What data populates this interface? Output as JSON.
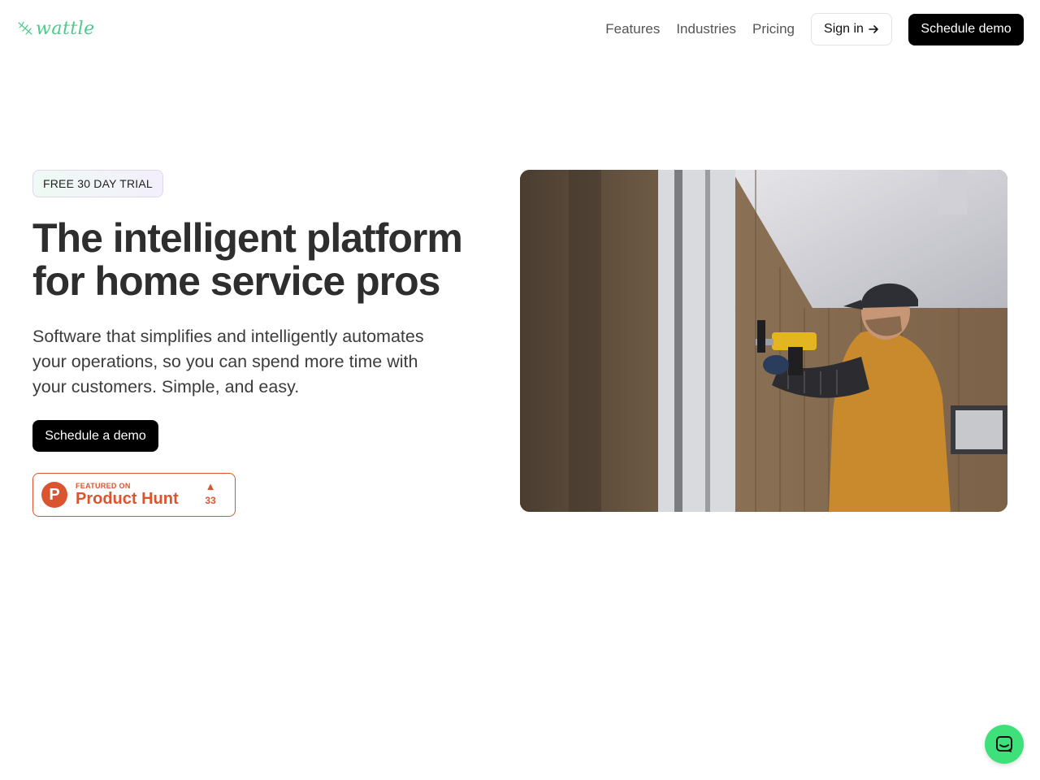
{
  "header": {
    "logo_text": "wattle",
    "logo_icon": "leaf-sprig-icon",
    "nav": {
      "features": "Features",
      "industries": "Industries",
      "pricing": "Pricing"
    },
    "sign_in_label": "Sign in",
    "sign_in_icon": "arrow-right-icon",
    "schedule_demo_label": "Schedule demo"
  },
  "hero": {
    "badge": "FREE 30 DAY TRIAL",
    "headline_line1": "The intelligent platform",
    "headline_line2": "for home service pros",
    "subhead": "Software that simplifies and intelligently automates your operations, so you can spend more time with your customers. Simple, and easy.",
    "cta_label": "Schedule a demo",
    "image_icon": "worker-drilling-photo"
  },
  "product_hunt": {
    "logo_letter": "P",
    "small_text": "FEATURED ON",
    "big_text": "Product Hunt",
    "votes": "33"
  },
  "chat": {
    "icon": "chat-icon",
    "color": "#3ee07a"
  },
  "colors": {
    "brand_green": "#4ccb8c",
    "cta_black": "#000000",
    "product_hunt_orange": "#da552f"
  }
}
